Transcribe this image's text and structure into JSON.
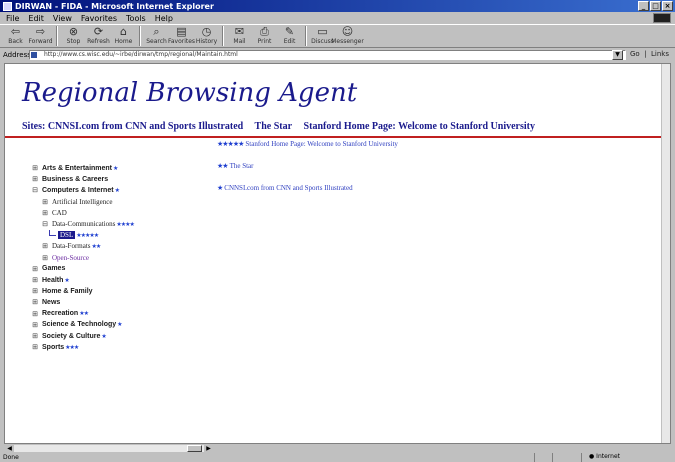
{
  "window": {
    "title": "DIRWAN - FIDA - Microsoft Internet Explorer"
  },
  "menu": [
    "File",
    "Edit",
    "View",
    "Favorites",
    "Tools",
    "Help"
  ],
  "toolbar": [
    {
      "name": "back-button",
      "label": "Back",
      "icon": "back-arrow-icon",
      "glyph": "⇦"
    },
    {
      "name": "forward-button",
      "label": "Forward",
      "icon": "forward-arrow-icon",
      "glyph": "⇨"
    },
    {
      "name": "stop-button",
      "label": "Stop",
      "icon": "stop-icon",
      "glyph": "⊗"
    },
    {
      "name": "refresh-button",
      "label": "Refresh",
      "icon": "refresh-icon",
      "glyph": "⟳"
    },
    {
      "name": "home-button",
      "label": "Home",
      "icon": "home-icon",
      "glyph": "⌂"
    },
    {
      "name": "search-button",
      "label": "Search",
      "icon": "search-icon",
      "glyph": "⌕"
    },
    {
      "name": "favorites-button",
      "label": "Favorites",
      "icon": "favorites-icon",
      "glyph": "▤"
    },
    {
      "name": "history-button",
      "label": "History",
      "icon": "history-icon",
      "glyph": "◷"
    },
    {
      "name": "mail-button",
      "label": "Mail",
      "icon": "mail-icon",
      "glyph": "✉"
    },
    {
      "name": "print-button",
      "label": "Print",
      "icon": "print-icon",
      "glyph": "⎙"
    },
    {
      "name": "edit-button",
      "label": "Edit",
      "icon": "edit-icon",
      "glyph": "✎"
    },
    {
      "name": "discuss-button",
      "label": "Discuss",
      "icon": "discuss-icon",
      "glyph": "▭"
    },
    {
      "name": "messenger-button",
      "label": "Messenger",
      "icon": "messenger-icon",
      "glyph": "☺"
    }
  ],
  "address": {
    "label": "Address",
    "value": "http://www.cs.wisc.edu/~irbe/dirwan/tmp/regional/Maintain.html",
    "go": "Go",
    "links": "Links"
  },
  "page": {
    "title": "Regional Browsing Agent",
    "top_links": [
      "Sites: CNNSI.com from CNN and Sports Illustrated",
      "The Star",
      "Stanford Home Page: Welcome to Stanford University"
    ]
  },
  "results": [
    {
      "stars": "★★★★★",
      "text": "Stanford Home Page: Welcome to Stanford University"
    },
    {
      "stars": "★★",
      "text": "The Star"
    },
    {
      "stars": "★",
      "text": "CNNSI.com from CNN and Sports Illustrated"
    }
  ],
  "tree": [
    {
      "label": "Arts & Entertainment",
      "stars": "★",
      "level": 0
    },
    {
      "label": "Business & Careers",
      "stars": "",
      "level": 0
    },
    {
      "label": "Computers & Internet",
      "stars": "★",
      "level": 0
    },
    {
      "label": "Artificial Intelligence",
      "stars": "",
      "level": 1
    },
    {
      "label": "CAD",
      "stars": "",
      "level": 1
    },
    {
      "label": "Data-Communications",
      "stars": "★★★★",
      "level": 1
    },
    {
      "label": "DSL",
      "stars": "★★★★★",
      "level": 2
    },
    {
      "label": "Data-Formats",
      "stars": "★★",
      "level": 1
    },
    {
      "label": "Open-Source",
      "stars": "",
      "level": 1
    },
    {
      "label": "Games",
      "stars": "",
      "level": 0
    },
    {
      "label": "Health",
      "stars": "★",
      "level": 0
    },
    {
      "label": "Home & Family",
      "stars": "",
      "level": 0
    },
    {
      "label": "News",
      "stars": "",
      "level": 0
    },
    {
      "label": "Recreation",
      "stars": "★★",
      "level": 0
    },
    {
      "label": "Science & Technology",
      "stars": "★",
      "level": 0
    },
    {
      "label": "Society & Culture",
      "stars": "★",
      "level": 0
    },
    {
      "label": "Sports",
      "stars": "★★★",
      "level": 0
    }
  ],
  "status": {
    "left": "Done",
    "zone": "Internet"
  },
  "colors": {
    "link": "#1a1a8c",
    "rule": "#c02020",
    "star": "#2040d0",
    "selected": "#1b1a8c"
  }
}
